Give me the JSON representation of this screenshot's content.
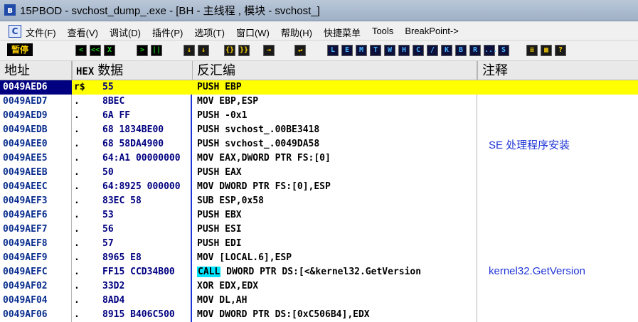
{
  "window": {
    "icon_glyph": "в",
    "title_text": "15PBOD - svchost_dump_.exe - [BH - 主线程 , 模块 - svchost_]"
  },
  "menu": {
    "icon_glyph": "C",
    "items": [
      "文件(F)",
      "查看(V)",
      "调试(D)",
      "插件(P)",
      "选项(T)",
      "窗口(W)",
      "帮助(H)",
      "快捷菜单",
      "Tools",
      "BreakPoint->"
    ]
  },
  "toolbar": {
    "status": "暂停",
    "buttons": [
      "<",
      "<<",
      "X",
      ">",
      "||",
      "↓",
      "↓",
      "{}",
      "}}",
      "→",
      "↵",
      "L",
      "E",
      "M",
      "T",
      "W",
      "H",
      "C",
      "/",
      "K",
      "B",
      "R",
      "...",
      "S",
      "≡",
      "▦",
      "?"
    ]
  },
  "columns": {
    "address": "地址",
    "hex": "HEX",
    "data": "数据",
    "disasm": "反汇编",
    "comment": "注释"
  },
  "rows": [
    {
      "addr": "0049AED6",
      "marker": "r$",
      "hex": "55",
      "disasm_pre": "PUSH EBP",
      "disasm_hl": "",
      "disasm_post": "",
      "comment": ""
    },
    {
      "addr": "0049AED7",
      "marker": ".",
      "hex": "8BEC",
      "disasm_pre": "MOV EBP,ESP",
      "disasm_hl": "",
      "disasm_post": "",
      "comment": ""
    },
    {
      "addr": "0049AED9",
      "marker": ".",
      "hex": "6A FF",
      "disasm_pre": "PUSH -0x1",
      "disasm_hl": "",
      "disasm_post": "",
      "comment": ""
    },
    {
      "addr": "0049AEDB",
      "marker": ".",
      "hex": "68 1834BE00",
      "disasm_pre": "PUSH svchost_.00BE3418",
      "disasm_hl": "",
      "disasm_post": "",
      "comment": ""
    },
    {
      "addr": "0049AEE0",
      "marker": ".",
      "hex": "68 58DA4900",
      "disasm_pre": "PUSH svchost_.0049DA58",
      "disasm_hl": "",
      "disasm_post": "",
      "comment": "SE 处理程序安装"
    },
    {
      "addr": "0049AEE5",
      "marker": ".",
      "hex": "64:A1 00000000",
      "disasm_pre": "MOV EAX,DWORD PTR FS:[0]",
      "disasm_hl": "",
      "disasm_post": "",
      "comment": ""
    },
    {
      "addr": "0049AEEB",
      "marker": ".",
      "hex": "50",
      "disasm_pre": "PUSH EAX",
      "disasm_hl": "",
      "disasm_post": "",
      "comment": ""
    },
    {
      "addr": "0049AEEC",
      "marker": ".",
      "hex": "64:8925 000000",
      "disasm_pre": "MOV DWORD PTR FS:[0],ESP",
      "disasm_hl": "",
      "disasm_post": "",
      "comment": ""
    },
    {
      "addr": "0049AEF3",
      "marker": ".",
      "hex": "83EC 58",
      "disasm_pre": "SUB ESP,0x58",
      "disasm_hl": "",
      "disasm_post": "",
      "comment": ""
    },
    {
      "addr": "0049AEF6",
      "marker": ".",
      "hex": "53",
      "disasm_pre": "PUSH EBX",
      "disasm_hl": "",
      "disasm_post": "",
      "comment": ""
    },
    {
      "addr": "0049AEF7",
      "marker": ".",
      "hex": "56",
      "disasm_pre": "PUSH ESI",
      "disasm_hl": "",
      "disasm_post": "",
      "comment": ""
    },
    {
      "addr": "0049AEF8",
      "marker": ".",
      "hex": "57",
      "disasm_pre": "PUSH EDI",
      "disasm_hl": "",
      "disasm_post": "",
      "comment": ""
    },
    {
      "addr": "0049AEF9",
      "marker": ".",
      "hex": "8965 E8",
      "disasm_pre": "MOV [LOCAL.6],ESP",
      "disasm_hl": "",
      "disasm_post": "",
      "comment": ""
    },
    {
      "addr": "0049AEFC",
      "marker": ".",
      "hex": "FF15 CCD34B00",
      "disasm_pre": "",
      "disasm_hl": "CALL",
      "disasm_post": " DWORD PTR DS:[<&kernel32.GetVersion",
      "comment": "kernel32.GetVersion"
    },
    {
      "addr": "0049AF02",
      "marker": ".",
      "hex": "33D2",
      "disasm_pre": "XOR EDX,EDX",
      "disasm_hl": "",
      "disasm_post": "",
      "comment": ""
    },
    {
      "addr": "0049AF04",
      "marker": ".",
      "hex": "8AD4",
      "disasm_pre": "MOV DL,AH",
      "disasm_hl": "",
      "disasm_post": "",
      "comment": ""
    },
    {
      "addr": "0049AF06",
      "marker": ".",
      "hex": "8915 B406C500",
      "disasm_pre": "MOV DWORD PTR DS:[0xC506B4],EDX",
      "disasm_hl": "",
      "disasm_post": "",
      "comment": ""
    }
  ]
}
